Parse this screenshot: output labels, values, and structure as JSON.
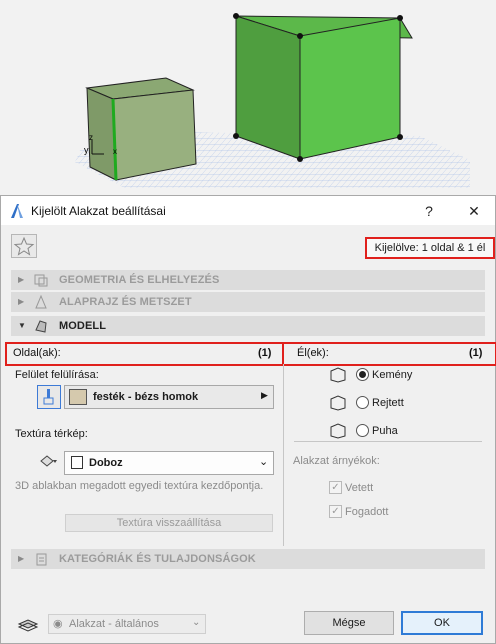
{
  "dialog": {
    "title": "Kijelölt Alakzat beállításai",
    "help_label": "?",
    "close_label": "✕",
    "selection_info": "Kijelölve: 1 oldal & 1 él"
  },
  "sections": [
    {
      "label": "GEOMETRIA ÉS ELHELYEZÉS",
      "icon": "geometry-icon",
      "expanded": false
    },
    {
      "label": "ALAPRAJZ ÉS METSZET",
      "icon": "floorplan-icon",
      "expanded": false
    },
    {
      "label": "MODELL",
      "icon": "model-icon",
      "expanded": true
    },
    {
      "label": "KATEGÓRIÁK ÉS TULAJDONSÁGOK",
      "icon": "categories-icon",
      "expanded": false
    }
  ],
  "faces": {
    "header": "Oldal(ak):",
    "count": "(1)",
    "override_label": "Felület felülírása:",
    "surface_value": "festék - bézs homok",
    "surface_swatch": "#d5c9ad",
    "texture_map_label": "Textúra térkép:",
    "texture_value": "Doboz",
    "info_text": "3D ablakban megadott egyedi textúra kezdőpontja.",
    "reset_button": "Textúra visszaállítása"
  },
  "edges": {
    "header": "Él(ek):",
    "count": "(1)",
    "options": [
      {
        "label": "Kemény",
        "selected": true
      },
      {
        "label": "Rejtett",
        "selected": false
      },
      {
        "label": "Puha",
        "selected": false
      }
    ],
    "shadows_label": "Alakzat árnyékok:",
    "shadow_options": [
      {
        "label": "Vetett",
        "checked": true
      },
      {
        "label": "Fogadott",
        "checked": true
      }
    ]
  },
  "footer": {
    "layer_value": "Alakzat - általános",
    "cancel_button": "Mégse",
    "ok_button": "OK"
  },
  "viewport": {
    "axis_y": "y",
    "axis_x": "x",
    "axis_z": "z",
    "box_color": "#5cc44c",
    "selected_edge_color": "#1faa1f"
  }
}
